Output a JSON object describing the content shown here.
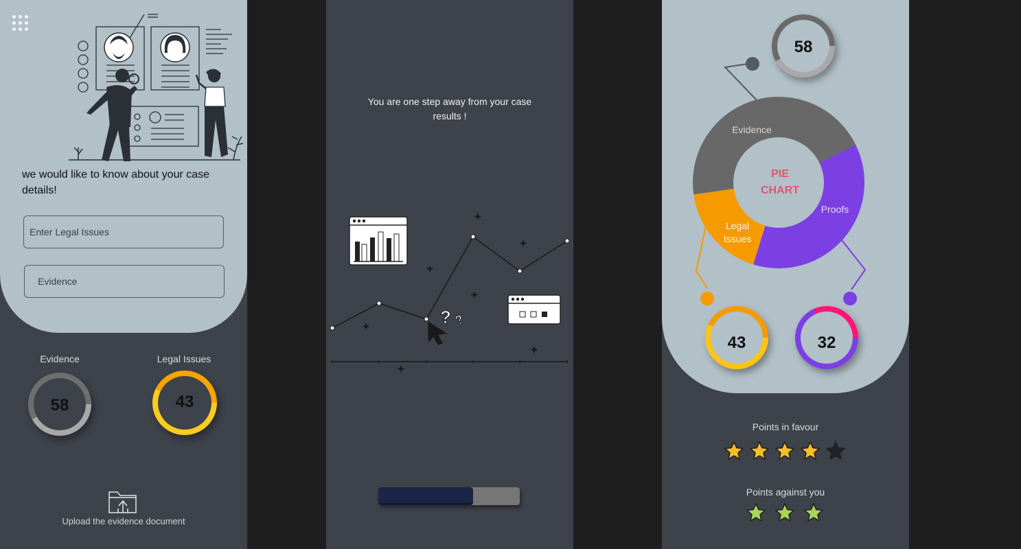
{
  "case_form": {
    "intro_text": "we would like to know about your case details!",
    "legal_issues_placeholder": "Enter Legal Issues",
    "evidence_placeholder": "Evidence",
    "stats": [
      {
        "label": "Evidence",
        "value": "58",
        "fraction": 0.58,
        "color": "#6e6e6e",
        "track": "#a8a8a8"
      },
      {
        "label": "Legal Issues",
        "value": "43",
        "fraction": 0.43,
        "color": "#f5a400",
        "track": "#ffcb1f"
      }
    ],
    "upload_text": "Upload the evidence document"
  },
  "loading": {
    "message": "You are one step away from your case results !",
    "progress_fraction": 0.67
  },
  "results": {
    "top_ring": {
      "value": "58",
      "fraction": 0.58
    },
    "chart_data": {
      "type": "pie",
      "center_label": "PIE CHART",
      "slices": [
        {
          "label": "Evidence",
          "value": 45,
          "color": "#686868"
        },
        {
          "label": "Proofs",
          "value": 37,
          "color": "#7b3fe4"
        },
        {
          "label": "Legal Issues",
          "value": 18,
          "color": "#f59a00"
        }
      ]
    },
    "rings": [
      {
        "value": "43",
        "fraction": 0.43,
        "color": "#f59a00",
        "track": "#ffc414"
      },
      {
        "value": "32",
        "fraction": 0.32,
        "color": "#ff1478",
        "track": "#7b3fe4"
      }
    ],
    "points_in_favour": {
      "label": "Points in favour",
      "filled": 4,
      "total": 5
    },
    "points_against": {
      "label": "Points against you",
      "count": 3
    }
  }
}
